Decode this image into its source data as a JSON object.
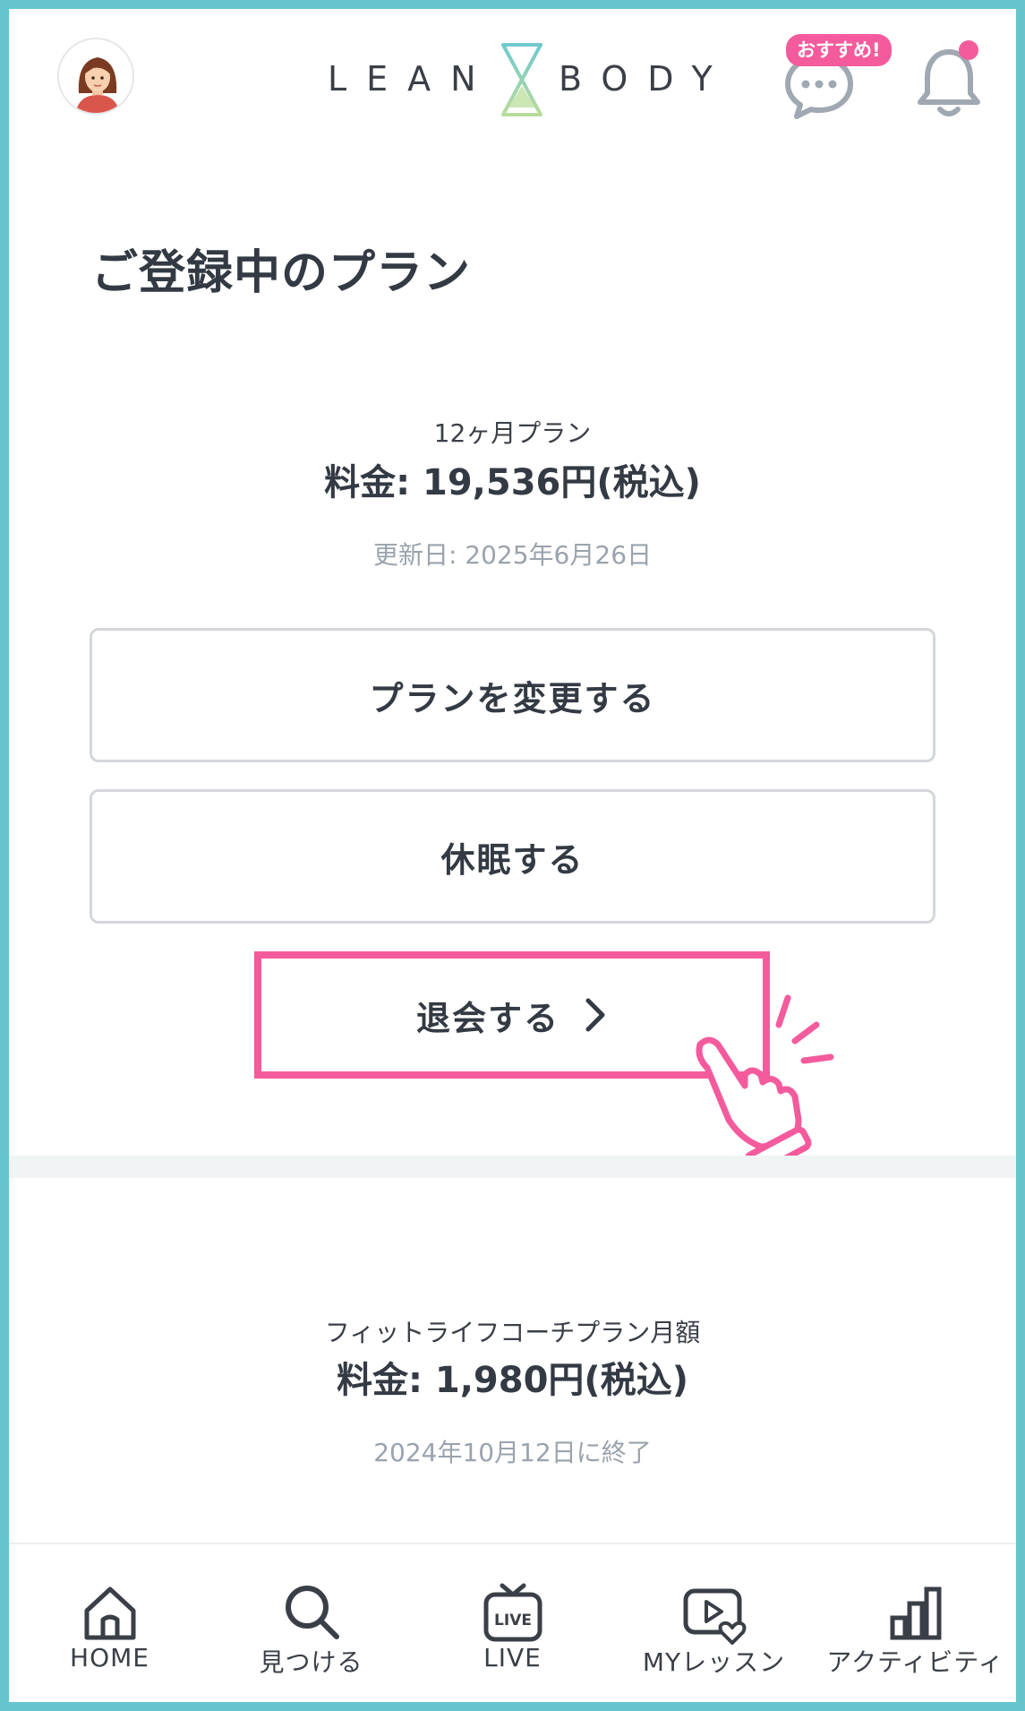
{
  "header": {
    "logo_left": "LEAN",
    "logo_right": "BODY",
    "badge": "おすすめ!"
  },
  "page_title": "ご登録中のプラン",
  "plans": [
    {
      "name": "12ヶ月プラン",
      "price": "料金: 19,536円(税込)",
      "date": "更新日: 2025年6月26日"
    },
    {
      "name": "フィットライフコーチプラン月額",
      "price": "料金: 1,980円(税込)",
      "date": "2024年10月12日に終了"
    }
  ],
  "actions": {
    "change_plan": "プランを変更する",
    "pause": "休眠する",
    "withdraw": "退会する"
  },
  "nav": [
    {
      "label": "HOME",
      "icon": "home-icon"
    },
    {
      "label": "見つける",
      "icon": "search-icon"
    },
    {
      "label": "LIVE",
      "icon": "live-tv-icon"
    },
    {
      "label": "MYレッスン",
      "icon": "my-lesson-icon"
    },
    {
      "label": "アクティビティ",
      "icon": "activity-icon"
    }
  ],
  "colors": {
    "frame": "#66c4cc",
    "accent_pink": "#f45b9c",
    "text_dark": "#343a43",
    "text_muted": "#9aa3ad",
    "icon_gray": "#a0a8b2"
  }
}
